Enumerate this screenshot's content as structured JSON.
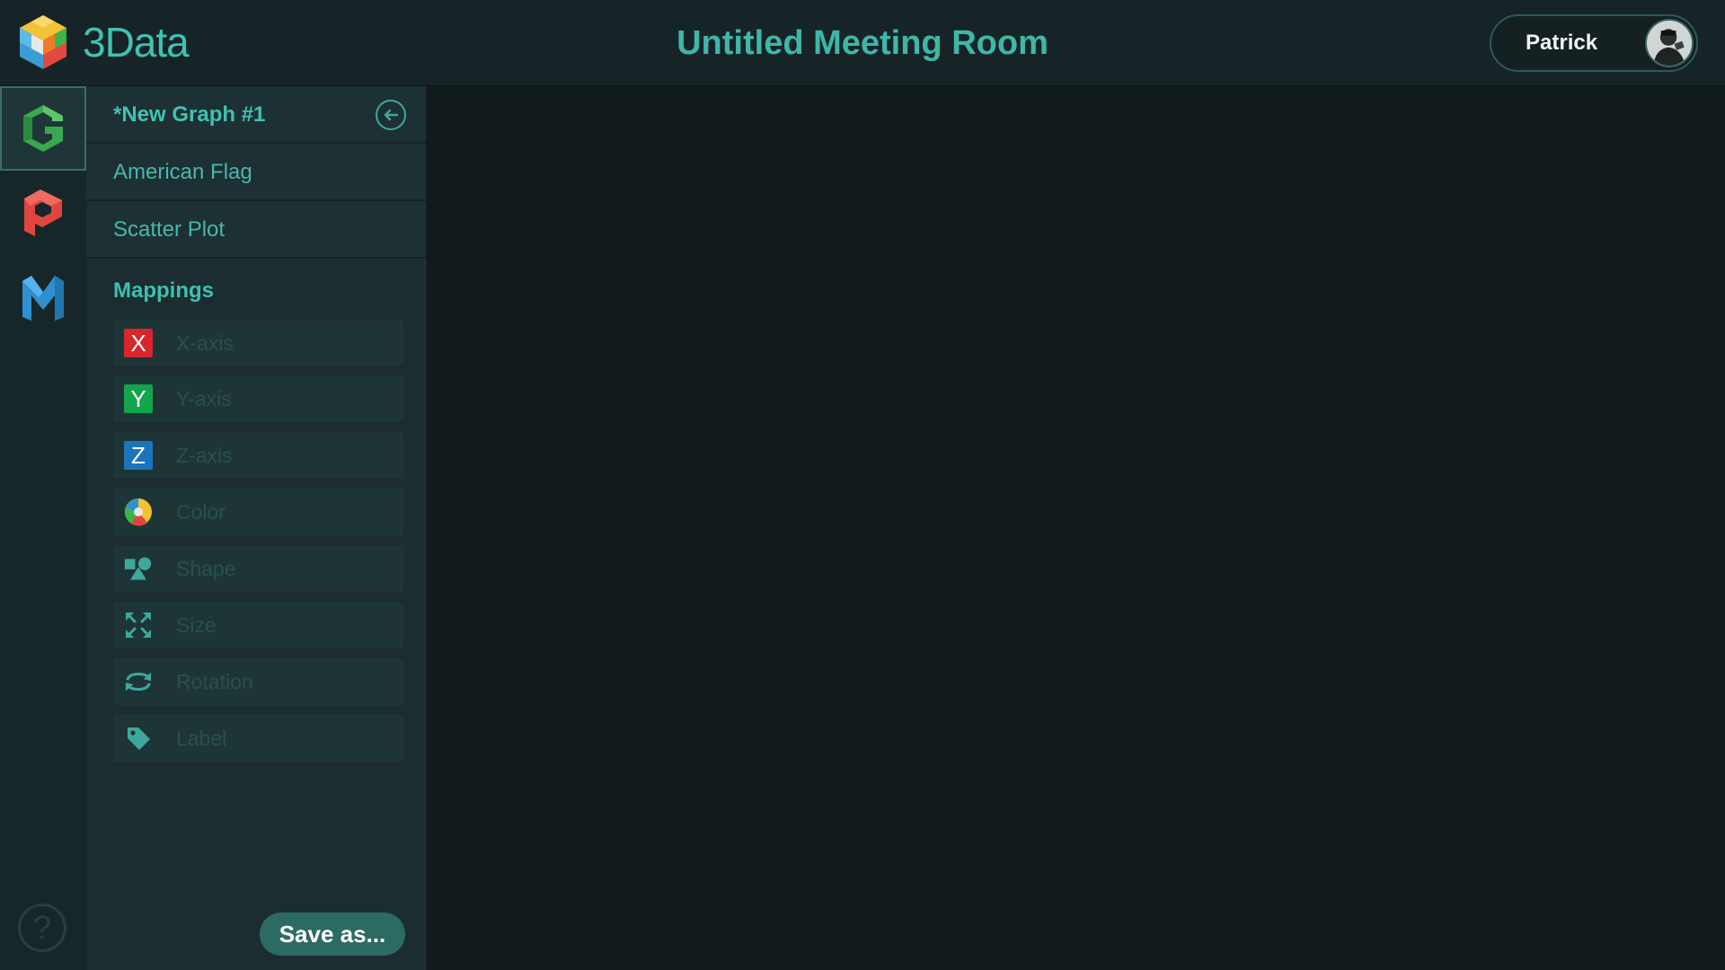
{
  "app": {
    "name": "3Data",
    "logo_icon": "cube-logo-icon"
  },
  "header": {
    "room_title": "Untitled Meeting Room"
  },
  "user": {
    "name": "Patrick",
    "avatar_icon": "user-avatar"
  },
  "rail": {
    "items": [
      {
        "icon": "graph-g-icon",
        "color": "#3aa84f",
        "active": true
      },
      {
        "icon": "presentation-p-icon",
        "color": "#e0463f",
        "active": false
      },
      {
        "icon": "map-m-icon",
        "color": "#2f8fd0",
        "active": false
      }
    ],
    "help_label": "?"
  },
  "panel": {
    "graphs": [
      {
        "label": "*New Graph #1",
        "current": true
      },
      {
        "label": "American Flag",
        "current": false
      },
      {
        "label": "Scatter Plot",
        "current": false
      }
    ],
    "mappings_title": "Mappings",
    "mappings": [
      {
        "label": "X-axis",
        "icon": "x-axis-icon",
        "letter": "X",
        "color": "#d8262c"
      },
      {
        "label": "Y-axis",
        "icon": "y-axis-icon",
        "letter": "Y",
        "color": "#12a54a"
      },
      {
        "label": "Z-axis",
        "icon": "z-axis-icon",
        "letter": "Z",
        "color": "#1b75bc"
      },
      {
        "label": "Color",
        "icon": "color-palette-icon"
      },
      {
        "label": "Shape",
        "icon": "shape-icon"
      },
      {
        "label": "Size",
        "icon": "size-icon"
      },
      {
        "label": "Rotation",
        "icon": "rotation-icon"
      },
      {
        "label": "Label",
        "icon": "label-tag-icon"
      }
    ],
    "save_label": "Save as..."
  },
  "colors": {
    "accent": "#40bfb0",
    "background": "#111b1c",
    "panel": "#1b2d30"
  }
}
